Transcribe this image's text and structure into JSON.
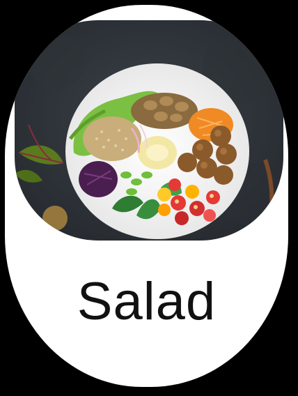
{
  "card": {
    "title": "Salad",
    "image_alt_icon": "salad-bowl-photo"
  },
  "colors": {
    "background": "#000000",
    "card_fill": "#ffffff",
    "card_border": "#000000",
    "title_text": "#111111"
  }
}
